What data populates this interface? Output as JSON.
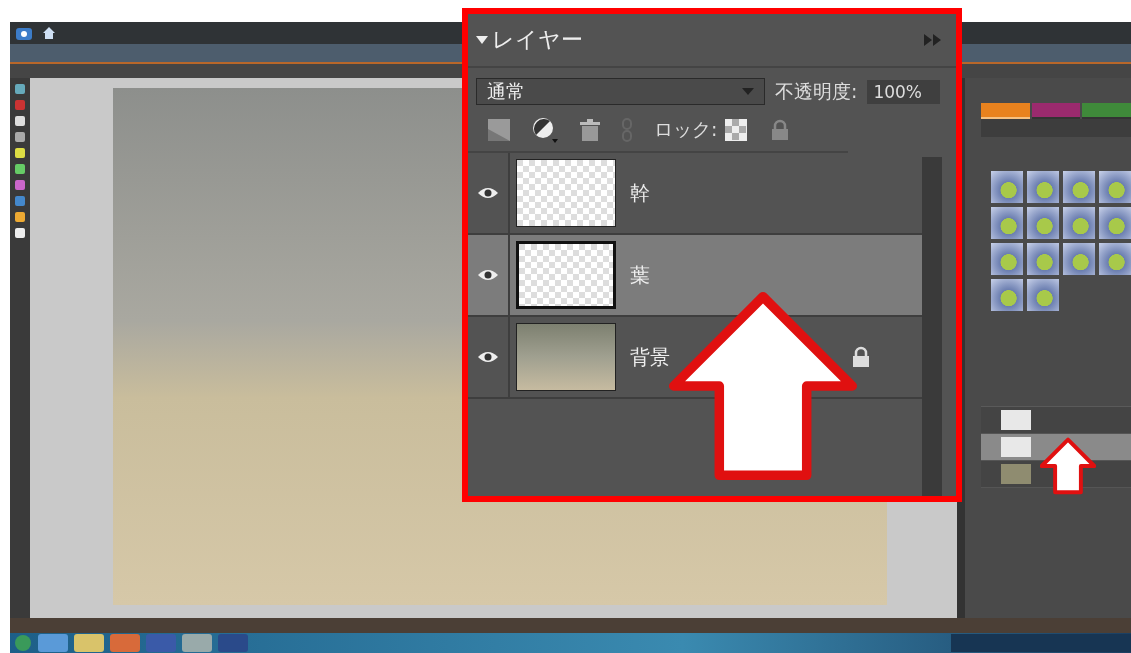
{
  "mode_tabs": [
    {
      "color": "#e8821e",
      "selected": true
    },
    {
      "color": "#9b2a6e",
      "selected": false
    },
    {
      "color": "#3f8a3a",
      "selected": false
    }
  ],
  "callout_panel": {
    "title": "レイヤー",
    "blend_mode": "通常",
    "opacity_label": "不透明度:",
    "opacity_value": "100%",
    "lock_label": "ロック:",
    "layers": [
      {
        "name": "幹",
        "kind": "transparent",
        "selected": false,
        "locked": false
      },
      {
        "name": "葉",
        "kind": "transparent",
        "selected": true,
        "locked": false
      },
      {
        "name": "背景",
        "kind": "photo",
        "selected": false,
        "locked": true
      }
    ]
  }
}
